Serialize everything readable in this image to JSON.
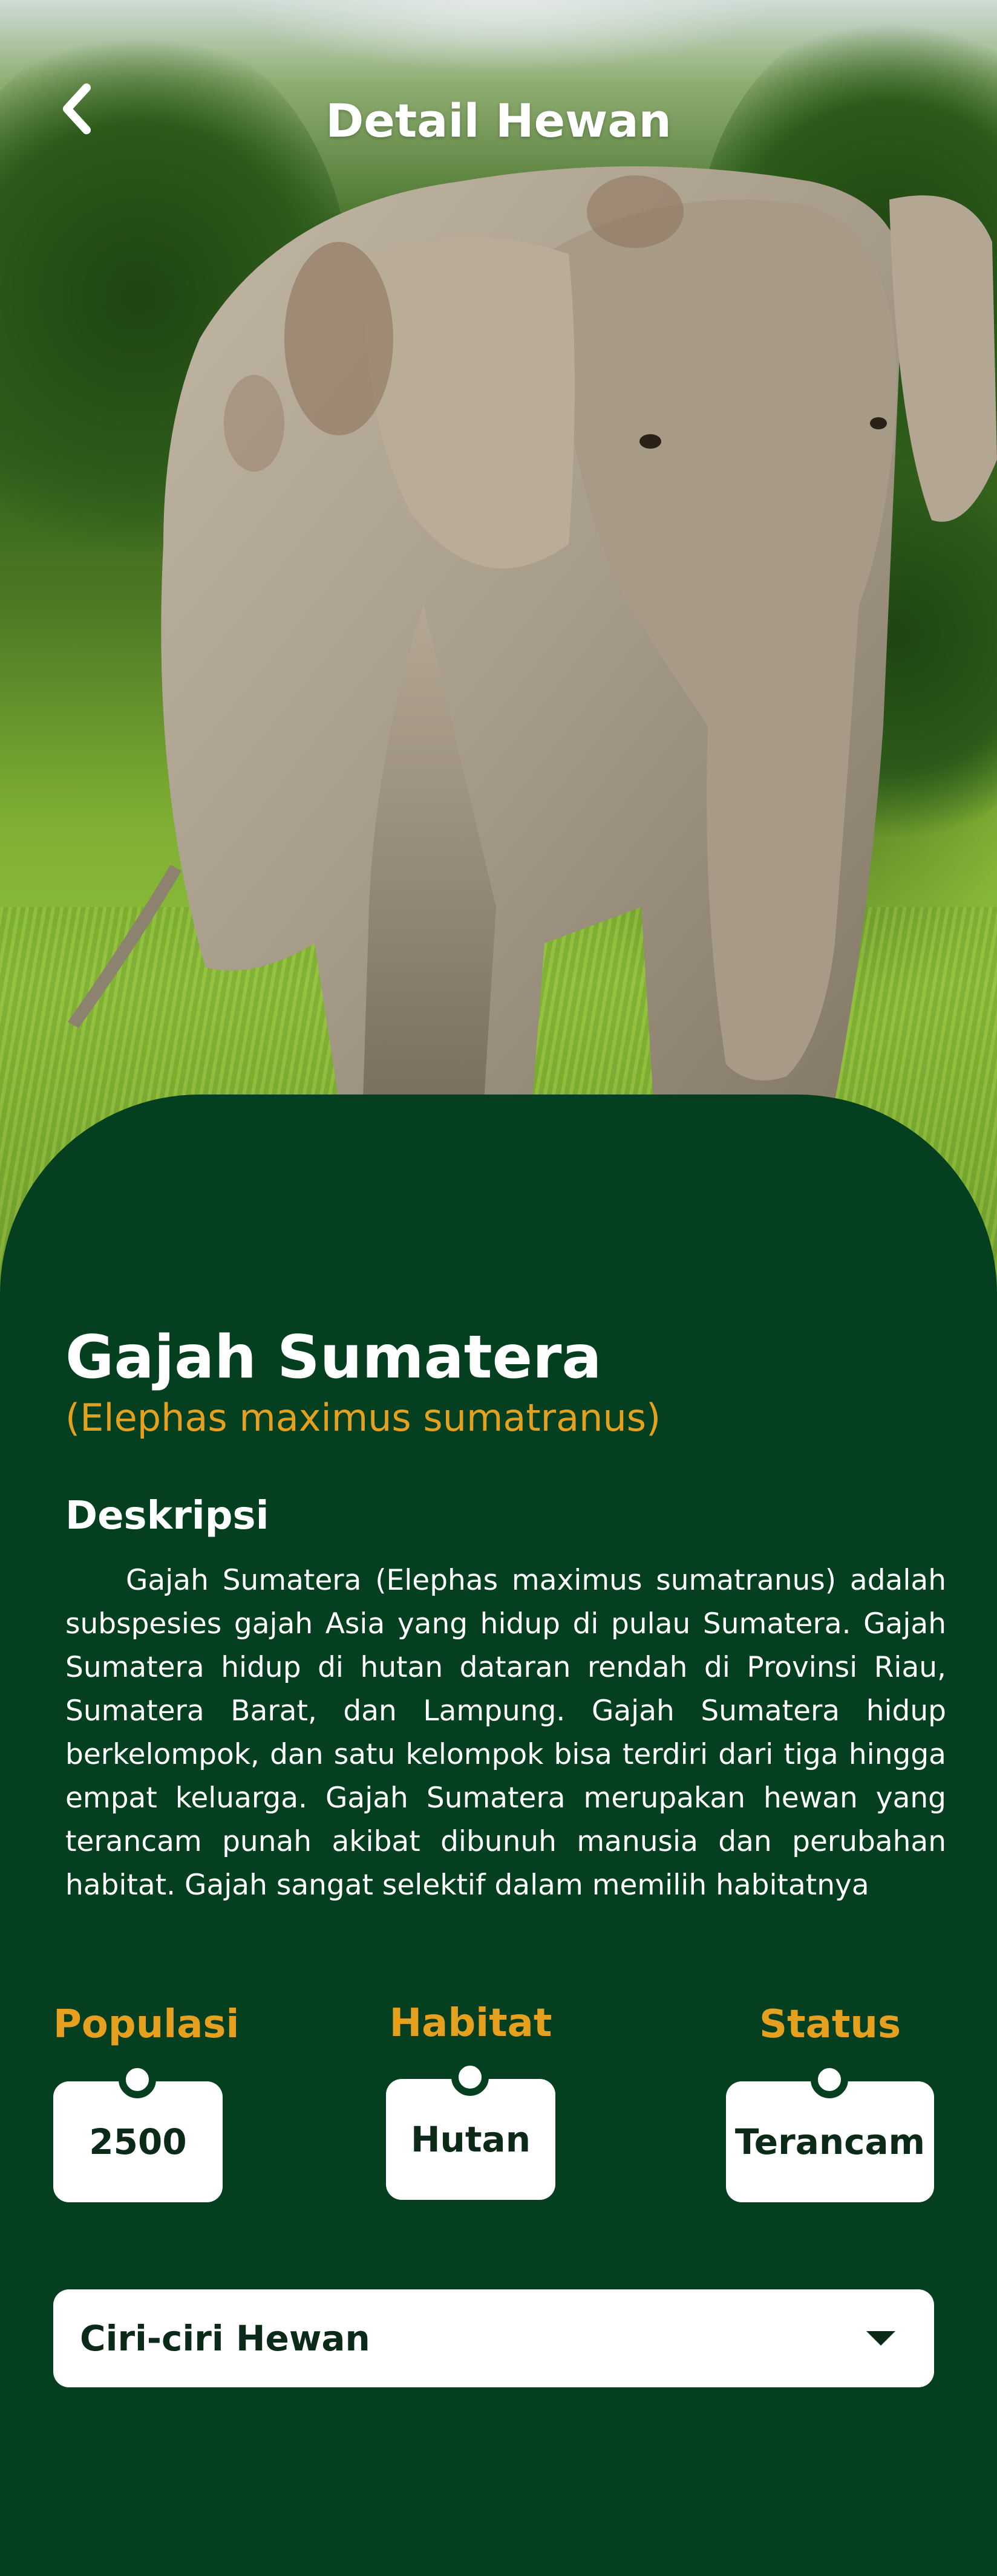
{
  "header": {
    "title": "Detail Hewan",
    "back_icon": "chevron-left-icon"
  },
  "animal": {
    "name": "Gajah Sumatera",
    "scientific_name": "(Elephas maximus sumatranus)"
  },
  "description": {
    "title": "Deskripsi",
    "text": "Gajah Sumatera (Elephas maximus sumatranus) adalah subspesies gajah Asia yang hidup di pulau Sumatera. Gajah Sumatera hidup di hutan dataran rendah di Provinsi Riau, Sumatera Barat, dan Lampung. Gajah Sumatera hidup berkelompok, dan satu kelompok bisa terdiri dari tiga hingga empat keluarga. Gajah Sumatera merupakan hewan yang terancam punah akibat dibunuh manusia dan perubahan habitat. Gajah sangat selektif dalam memilih habitatnya"
  },
  "stats": {
    "population": {
      "label": "Populasi",
      "value": "2500"
    },
    "habitat": {
      "label": "Habitat",
      "value": "Hutan"
    },
    "status": {
      "label": "Status",
      "value": "Terancam"
    }
  },
  "dropdown": {
    "label": "Ciri-ciri Hewan",
    "icon": "caret-down-icon"
  },
  "colors": {
    "panel": "#04401f",
    "accent": "#e6a020",
    "card": "#ffffff",
    "card_text": "#0b2a18"
  }
}
